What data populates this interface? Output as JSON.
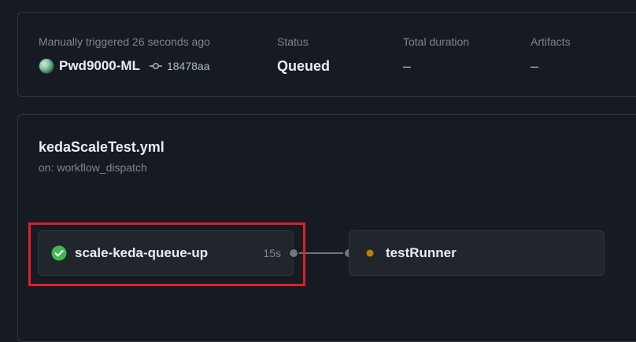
{
  "run_summary": {
    "trigger_text": "Manually triggered 26 seconds ago",
    "actor_name": "Pwd9000-ML",
    "commit_sha": "18478aa",
    "status_label": "Status",
    "status_value": "Queued",
    "duration_label": "Total duration",
    "duration_value": "–",
    "artifacts_label": "Artifacts",
    "artifacts_value": "–"
  },
  "workflow": {
    "file_name": "kedaScaleTest.yml",
    "trigger": "on: workflow_dispatch",
    "jobs": [
      {
        "name": "scale-keda-queue-up",
        "duration": "15s",
        "status": "success"
      },
      {
        "name": "testRunner",
        "duration": "",
        "status": "queued"
      }
    ]
  },
  "colors": {
    "success": "#3fb950",
    "queued": "#bb8009",
    "highlight": "#e11d2a"
  }
}
